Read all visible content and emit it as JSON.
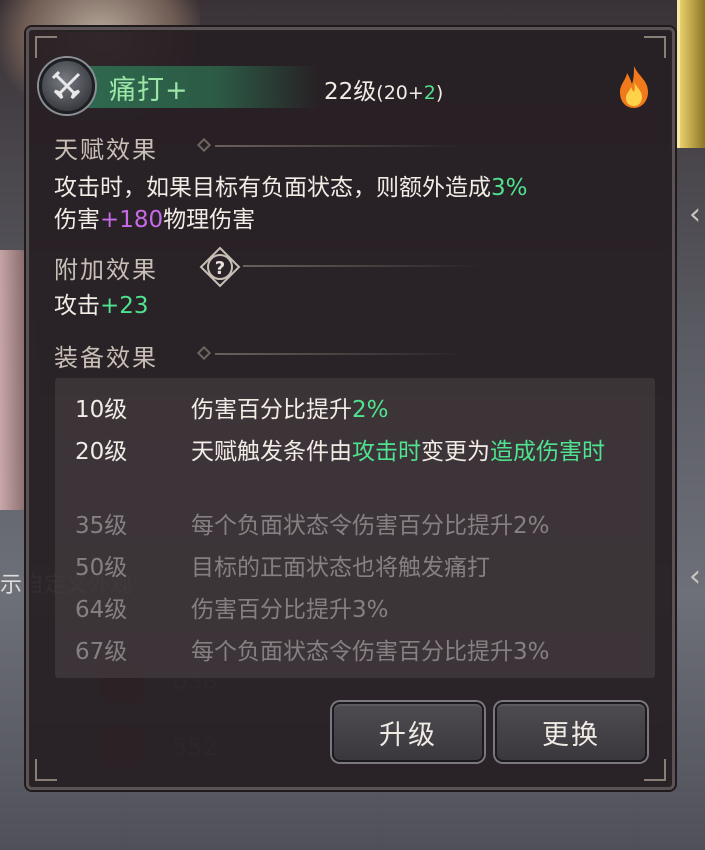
{
  "background": {
    "custom_appearance_label": "示自定义外观",
    "stats": [
      {
        "icon": "shield-badge-icon",
        "value": "638"
      },
      {
        "icon": "fire-badge-icon",
        "value": "552"
      }
    ]
  },
  "skill": {
    "name": "痛打+",
    "level_main": "22级",
    "level_open": "(20+",
    "level_bonus": "2",
    "level_close": ")",
    "icon": "crossed-swords-icon",
    "element_icon": "fire-icon"
  },
  "talent": {
    "title": "天赋效果",
    "line1_prefix": "攻击时，如果目标有负面状态，则额外造成",
    "line1_value": "3%",
    "line2_prefix": "伤害",
    "line2_value": "+180",
    "line2_suffix": "物理伤害"
  },
  "bonus": {
    "title": "附加效果",
    "help_icon": "question-icon",
    "text_prefix": "攻击",
    "text_value": "+23"
  },
  "equipment": {
    "title": "装备效果",
    "rows": [
      {
        "level": "10级",
        "desc_prefix": "伤害百分比提升",
        "desc_value": "2%",
        "active": true
      },
      {
        "level": "20级",
        "desc_prefix": "天赋触发条件由",
        "desc_hl1": "攻击时",
        "desc_mid": "变更为",
        "desc_hl2": "造成伤害时",
        "active": true
      },
      {
        "level": "35级",
        "desc": "每个负面状态令伤害百分比提升2%",
        "active": false
      },
      {
        "level": "50级",
        "desc": "目标的正面状态也将触发痛打",
        "active": false
      },
      {
        "level": "64级",
        "desc": "伤害百分比提升3%",
        "active": false
      },
      {
        "level": "67级",
        "desc": "每个负面状态令伤害百分比提升3%",
        "active": false
      }
    ]
  },
  "buttons": {
    "upgrade": "升级",
    "replace": "更换"
  },
  "colors": {
    "green_highlight": "#4fe38f",
    "purple_highlight": "#c66ae8",
    "skill_name": "#9be5a6",
    "locked_text": "#878082"
  }
}
